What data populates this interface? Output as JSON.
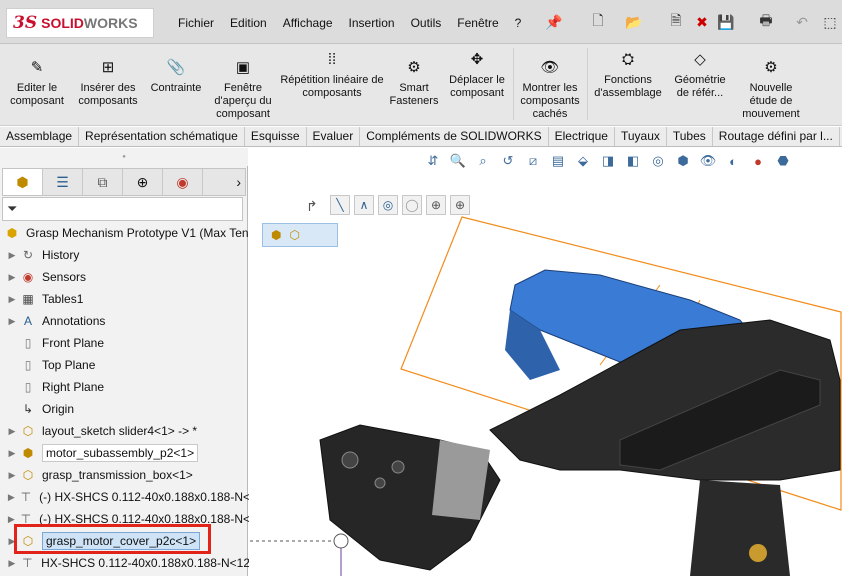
{
  "app": {
    "logo_ds": "3S",
    "logo_name_a": "SOLID",
    "logo_name_b": "WORKS"
  },
  "menu": [
    "Fichier",
    "Edition",
    "Affichage",
    "Insertion",
    "Outils",
    "Fenêtre",
    "?"
  ],
  "ribbon": {
    "edit_component": "Editer le composant",
    "insert_components": "Insérer des composants",
    "mate": "Contrainte",
    "preview_window": "Fenêtre d'aperçu du composant",
    "linear_pattern": "Répétition linéaire de composants",
    "smart_fasteners": "Smart Fasteners",
    "move_component": "Déplacer le composant",
    "show_hidden": "Montrer les composants cachés",
    "assembly_features": "Fonctions d'assemblage",
    "ref_geometry": "Géométrie de référ...",
    "new_motion_study": "Nouvelle étude de mouvement"
  },
  "tabs": [
    "Assemblage",
    "Représentation schématique",
    "Esquisse",
    "Evaluer",
    "Compléments de SOLIDWORKS",
    "Electrique",
    "Tuyaux",
    "Tubes",
    "Routage défini par l..."
  ],
  "tree": {
    "root": "Grasp Mechanism Prototype V1  (Max Ten",
    "items": [
      {
        "label": "History",
        "icon": "history-icon"
      },
      {
        "label": "Sensors",
        "icon": "sensor-icon"
      },
      {
        "label": "Tables1",
        "icon": "table-icon"
      },
      {
        "label": "Annotations",
        "icon": "annotation-icon"
      },
      {
        "label": "Front Plane",
        "icon": "plane-icon"
      },
      {
        "label": "Top Plane",
        "icon": "plane-icon"
      },
      {
        "label": "Right Plane",
        "icon": "plane-icon"
      },
      {
        "label": "Origin",
        "icon": "origin-icon"
      },
      {
        "label": "layout_sketch slider4<1> -> *",
        "icon": "part-icon"
      },
      {
        "label": "motor_subassembly_p2<1>",
        "icon": "assembly-icon"
      },
      {
        "label": "grasp_transmission_box<1>",
        "icon": "part-icon"
      },
      {
        "label": "(-) HX-SHCS 0.112-40x0.188x0.188-N<",
        "icon": "screw-icon"
      },
      {
        "label": "(-) HX-SHCS 0.112-40x0.188x0.188-N<",
        "icon": "screw-icon"
      },
      {
        "label": "grasp_motor_cover_p2c<1>",
        "icon": "part-icon"
      },
      {
        "label": "HX-SHCS 0.112-40x0.188x0.188-N<12",
        "icon": "screw-icon"
      }
    ]
  },
  "colors": {
    "accent": "#1f6fd1",
    "highlight": "#e2231a",
    "selected": "#cfe3f7",
    "edge": "#f28c1b"
  }
}
